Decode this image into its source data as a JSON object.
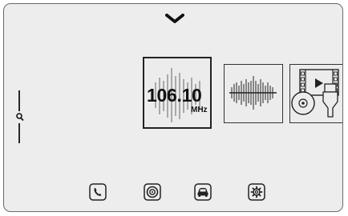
{
  "header": {
    "expand_icon": "chevron-down-icon"
  },
  "side_control": {
    "icon": "search-icon"
  },
  "tiles": {
    "radio": {
      "frequency": "106.10",
      "unit": "MHz"
    },
    "tuner": {
      "icon": "frequency-scale-icon"
    },
    "media": {
      "icon": "film-disc-usb-icon"
    }
  },
  "bottom_nav": [
    {
      "icon": "phone-icon"
    },
    {
      "icon": "disc-icon"
    },
    {
      "icon": "car-icon"
    },
    {
      "icon": "gear-icon"
    }
  ],
  "colors": {
    "screen_background": "#ededed",
    "frame": "#6a6a6a",
    "ink": "#222222"
  }
}
